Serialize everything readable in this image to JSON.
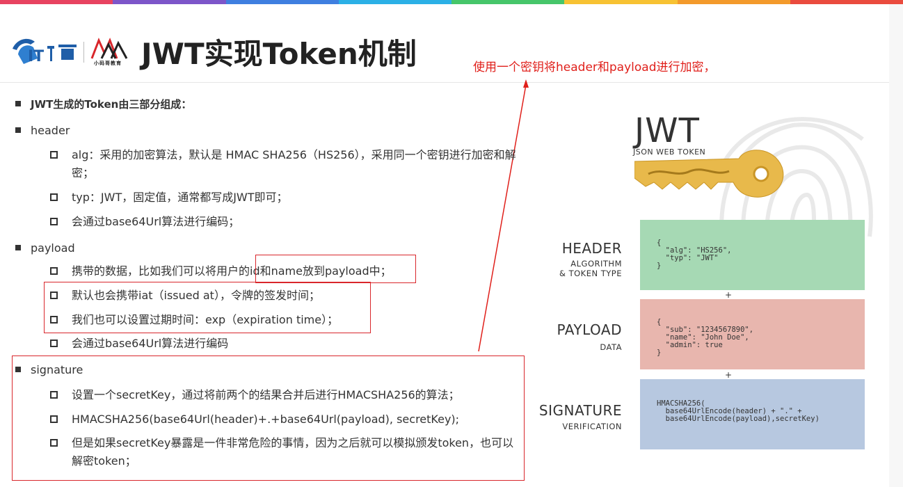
{
  "colors": {
    "rainbow": [
      "#e84360",
      "#7d56c9",
      "#3f7fe0",
      "#2bb0e6",
      "#46c66a",
      "#f7c233",
      "#f39a2b",
      "#ea4b3e"
    ],
    "annotation_red": "#e0201b",
    "header_panel": "#a6d9b4",
    "payload_panel": "#e8b6ae",
    "signature_panel": "#b7c8e0",
    "key_gold": "#e8b94b"
  },
  "header": {
    "logo_sub": "小码哥教育",
    "title": "JWT实现Token机制",
    "annotation": "使用一个密钥将header和payload进行加密，"
  },
  "content": {
    "intro": "JWT生成的Token由三部分组成：",
    "header_label": "header",
    "header_items": [
      "alg：采用的加密算法，默认是 HMAC SHA256（HS256），采用同一个密钥进行加密和解密；",
      "typ：JWT，固定值，通常都写成JWT即可；",
      "会通过base64Url算法进行编码；"
    ],
    "payload_label": "payload",
    "payload_items": [
      "携带的数据，比如我们可以将用户的id和name放到payload中；",
      "默认也会携带iat（issued at），令牌的签发时间；",
      "我们也可以设置过期时间：exp（expiration time）；",
      "会通过base64Url算法进行编码"
    ],
    "signature_label": "signature",
    "signature_items": [
      "设置一个secretKey，通过将前两个的结果合并后进行HMACSHA256的算法；",
      "HMACSHA256(base64Url(header)+.+base64Url(payload), secretKey);",
      "但是如果secretKey暴露是一件非常危险的事情，因为之后就可以模拟颁发token，也可以解密token；"
    ]
  },
  "jwt_figure": {
    "logo_title": "JWT",
    "logo_subtitle": "JSON WEB TOKEN",
    "header_title": "HEADER",
    "header_sub1": "ALGORITHM",
    "header_sub2": "& TOKEN TYPE",
    "header_code": "{\n  \"alg\": \"HS256\",\n  \"typ\": \"JWT\"\n}",
    "payload_title": "PAYLOAD",
    "payload_sub": "DATA",
    "payload_code": "{\n  \"sub\": \"1234567890\",\n  \"name\": \"John Doe\",\n  \"admin\": true\n}",
    "signature_title": "SIGNATURE",
    "signature_sub": "VERIFICATION",
    "signature_code": "HMACSHA256(\n  base64UrlEncode(header) + \".\" +\n  base64UrlEncode(payload),secretKey)",
    "plus": "+"
  }
}
